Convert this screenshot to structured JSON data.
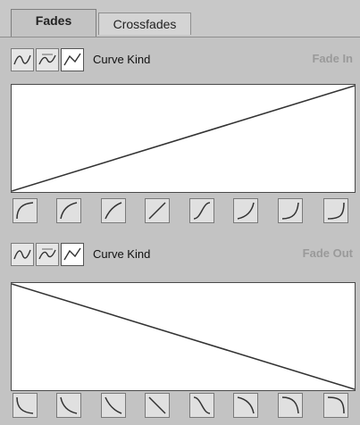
{
  "tabs": [
    {
      "label": "Fades",
      "active": true
    },
    {
      "label": "Crossfades",
      "active": false
    }
  ],
  "fade_in": {
    "curve_kind_label": "Curve Kind",
    "title": "Fade In",
    "curve_kind_buttons": [
      "curve-kind-spline-icon",
      "curve-kind-damped-spline-icon",
      "curve-kind-linear-icon"
    ],
    "selected_kind": 2,
    "presets": [
      "fade-in-preset-1-icon",
      "fade-in-preset-2-icon",
      "fade-in-preset-3-icon",
      "fade-in-preset-4-icon",
      "fade-in-preset-5-icon",
      "fade-in-preset-6-icon",
      "fade-in-preset-7-icon",
      "fade-in-preset-8-icon"
    ]
  },
  "fade_out": {
    "curve_kind_label": "Curve Kind",
    "title": "Fade Out",
    "curve_kind_buttons": [
      "curve-kind-spline-icon",
      "curve-kind-damped-spline-icon",
      "curve-kind-linear-icon"
    ],
    "selected_kind": 2,
    "presets": [
      "fade-out-preset-1-icon",
      "fade-out-preset-2-icon",
      "fade-out-preset-3-icon",
      "fade-out-preset-4-icon",
      "fade-out-preset-5-icon",
      "fade-out-preset-6-icon",
      "fade-out-preset-7-icon",
      "fade-out-preset-8-icon"
    ]
  },
  "colors": {
    "panel_bg": "#c3c3c3",
    "curve_bg": "#ffffff",
    "curve_line": "#333333",
    "label_dim": "#9a9a9a"
  }
}
